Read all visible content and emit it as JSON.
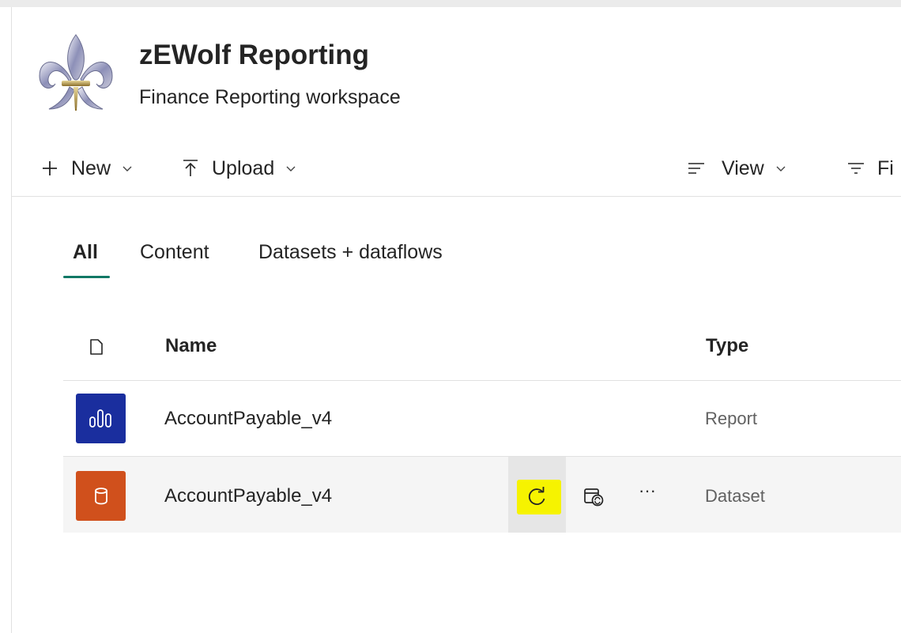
{
  "workspace": {
    "title": "zEWolf Reporting",
    "subtitle": "Finance Reporting workspace"
  },
  "toolbar": {
    "new_label": "New",
    "upload_label": "Upload",
    "view_label": "View",
    "filter_label": "Fi"
  },
  "tabs": [
    {
      "label": "All",
      "active": true
    },
    {
      "label": "Content",
      "active": false
    },
    {
      "label": "Datasets + dataflows",
      "active": false
    }
  ],
  "table": {
    "columns": {
      "name": "Name",
      "type": "Type"
    },
    "rows": [
      {
        "name": "AccountPayable_v4",
        "type": "Report",
        "icon": "report-icon"
      },
      {
        "name": "AccountPayable_v4",
        "type": "Dataset",
        "icon": "dataset-icon"
      }
    ],
    "more_label": "···"
  },
  "colors": {
    "accent_tab": "#117865",
    "report_icon_bg": "#1a2e9e",
    "dataset_icon_bg": "#d0501c",
    "highlight": "#f6f300"
  }
}
